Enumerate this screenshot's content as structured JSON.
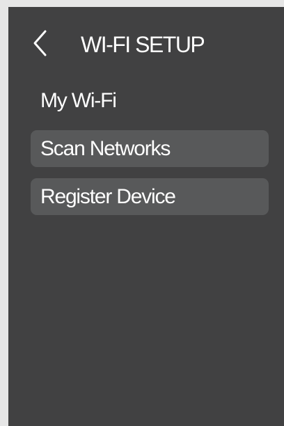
{
  "header": {
    "back_icon": "chevron-left-icon",
    "title": "WI-FI SETUP"
  },
  "menu": {
    "items": [
      {
        "label": "My Wi-Fi"
      },
      {
        "label": "Scan Networks"
      },
      {
        "label": "Register Device"
      }
    ]
  },
  "colors": {
    "panel_background": "#414142",
    "button_background": "#58595a",
    "outer_background": "#e6e6e6",
    "text": "#ffffff"
  }
}
